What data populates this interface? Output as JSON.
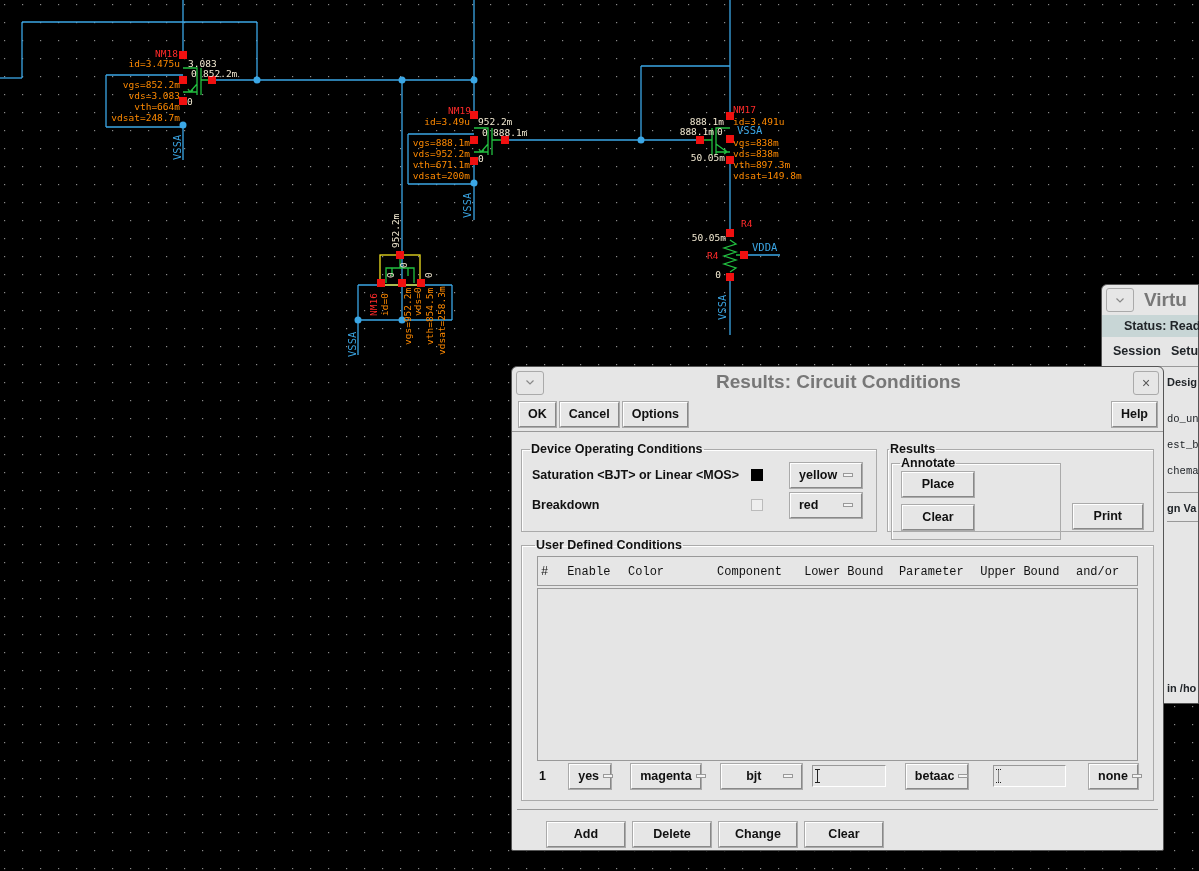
{
  "schematic": {
    "labels": [
      {
        "text": "NM18",
        "kind": "instance"
      },
      {
        "text": "id=3.475u",
        "kind": "parameter"
      },
      {
        "text": "3.083",
        "kind": "voltage"
      },
      {
        "text": "0",
        "kind": "voltage"
      },
      {
        "text": "852.2m",
        "kind": "voltage"
      },
      {
        "text": "vgs=852.2m",
        "kind": "parameter"
      },
      {
        "text": "vds=3.083",
        "kind": "parameter"
      },
      {
        "text": "0",
        "kind": "voltage"
      },
      {
        "text": "vth=664m",
        "kind": "parameter"
      },
      {
        "text": "vdsat=248.7m",
        "kind": "parameter"
      },
      {
        "text": "VSSA",
        "kind": "net"
      },
      {
        "text": "NM19",
        "kind": "instance"
      },
      {
        "text": "id=3.49u",
        "kind": "parameter"
      },
      {
        "text": "952.2m",
        "kind": "voltage"
      },
      {
        "text": "0",
        "kind": "voltage"
      },
      {
        "text": "888.1m",
        "kind": "voltage"
      },
      {
        "text": "vgs=888.1m",
        "kind": "parameter"
      },
      {
        "text": "vds=952.2m",
        "kind": "parameter"
      },
      {
        "text": "0",
        "kind": "voltage"
      },
      {
        "text": "vth=671.1m",
        "kind": "parameter"
      },
      {
        "text": "vdsat=200m",
        "kind": "parameter"
      },
      {
        "text": "VSSA",
        "kind": "net"
      },
      {
        "text": "NM17",
        "kind": "instance"
      },
      {
        "text": "888.1m",
        "kind": "voltage"
      },
      {
        "text": "id=3.491u",
        "kind": "parameter"
      },
      {
        "text": "888.1m",
        "kind": "voltage"
      },
      {
        "text": "0",
        "kind": "voltage"
      },
      {
        "text": "VSSA",
        "kind": "net"
      },
      {
        "text": "vgs=838m",
        "kind": "parameter"
      },
      {
        "text": "vds=838m",
        "kind": "parameter"
      },
      {
        "text": "50.05m",
        "kind": "voltage"
      },
      {
        "text": "vth=897.3m",
        "kind": "parameter"
      },
      {
        "text": "vdsat=149.8m",
        "kind": "parameter"
      },
      {
        "text": "R4",
        "kind": "instance"
      },
      {
        "text": "50.05m",
        "kind": "voltage"
      },
      {
        "text": "R4",
        "kind": "instance"
      },
      {
        "text": "VDDA",
        "kind": "net"
      },
      {
        "text": "0",
        "kind": "voltage"
      },
      {
        "text": "VSSA",
        "kind": "net"
      },
      {
        "text": "952.2m",
        "kind": "voltage"
      },
      {
        "text": "0",
        "kind": "voltage"
      },
      {
        "text": "0",
        "kind": "voltage"
      },
      {
        "text": "0",
        "kind": "voltage"
      },
      {
        "text": "NM16",
        "kind": "instance"
      },
      {
        "text": "id=0",
        "kind": "parameter"
      },
      {
        "text": "vgs=952.2m",
        "kind": "parameter"
      },
      {
        "text": "vds=0",
        "kind": "parameter"
      },
      {
        "text": "vth=854.5m",
        "kind": "parameter"
      },
      {
        "text": "vdsat=258.3m",
        "kind": "parameter"
      },
      {
        "text": "VSSA",
        "kind": "net"
      }
    ]
  },
  "background_window": {
    "title": "Virtu",
    "status": "Status: Read",
    "menu": [
      "Session",
      "Setu"
    ],
    "lines": [
      {
        "text": "Desig",
        "kind": "heading"
      },
      {
        "text": "do_un",
        "kind": "mono"
      },
      {
        "text": "est_b",
        "kind": "mono"
      },
      {
        "text": "chema",
        "kind": "mono"
      },
      {
        "text": "gn Va",
        "kind": "heading"
      },
      {
        "text": "in /ho",
        "kind": "footer"
      }
    ]
  },
  "dialog": {
    "title": "Results: Circuit Conditions",
    "close_glyph": "×",
    "toolbar": [
      "OK",
      "Cancel",
      "Options"
    ],
    "help_button": "Help",
    "device_operating_conditions": {
      "title": "Device Operating Conditions",
      "rows": [
        {
          "label": "Saturation <BJT> or Linear <MOS>",
          "checked": true,
          "color_choice": "yellow"
        },
        {
          "label": "Breakdown",
          "checked": false,
          "color_choice": "red"
        }
      ]
    },
    "results": {
      "title": "Results",
      "annotate": {
        "title": "Annotate",
        "buttons": [
          "Place",
          "Clear"
        ]
      },
      "print_button": "Print"
    },
    "user_defined_conditions": {
      "title": "User Defined Conditions",
      "columns": [
        "#",
        "Enable",
        "Color",
        "Component",
        "Lower Bound",
        "Parameter",
        "Upper Bound",
        "and/or"
      ],
      "rows": [
        {
          "number": "1",
          "enable": "yes",
          "color_choice": "magenta",
          "component": "bjt",
          "parameter": "betaac",
          "and_or": "none"
        }
      ]
    },
    "buttons": [
      "Add",
      "Delete",
      "Change",
      "Clear"
    ]
  }
}
